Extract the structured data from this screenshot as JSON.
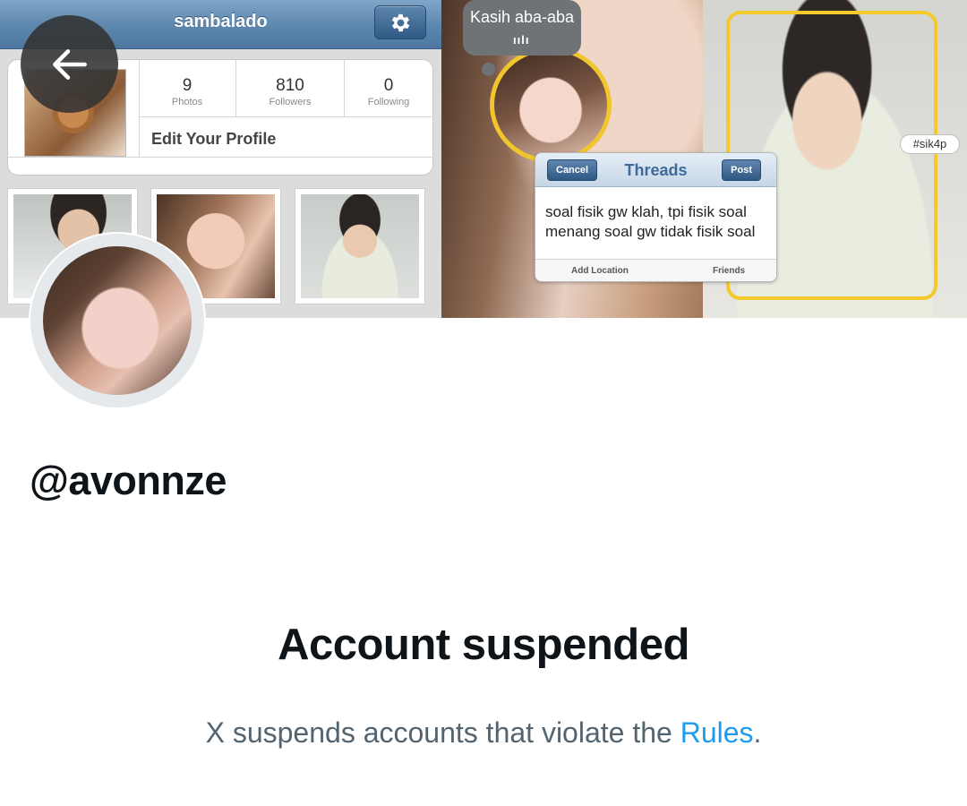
{
  "banner": {
    "profile_ui": {
      "username": "sambalado",
      "stats": [
        {
          "value": "9",
          "label": "Photos"
        },
        {
          "value": "810",
          "label": "Followers"
        },
        {
          "value": "0",
          "label": "Following"
        }
      ],
      "edit_label": "Edit Your Profile"
    },
    "speech_bubble": {
      "text": "Kasih aba-aba",
      "wave": "ıılı"
    },
    "threads_dialog": {
      "cancel_label": "Cancel",
      "title": "Threads",
      "post_label": "Post",
      "body_line1": "soal fisik gw klah, tpi fisik soal",
      "body_line2": "menang soal gw tidak fisik soal",
      "location_label": "Add Location",
      "friends_label": "Friends"
    },
    "tag": "#sik4p"
  },
  "profile": {
    "handle": "@avonnze"
  },
  "suspension": {
    "title": "Account suspended",
    "desc_prefix": "X suspends accounts that violate the ",
    "rules_link": "Rules",
    "desc_suffix": "."
  },
  "icons": {
    "back": "arrow-left-icon",
    "settings": "gear-icon"
  },
  "colors": {
    "link": "#1d9bf0",
    "secondary_text": "#536471",
    "primary_text": "#0f1419",
    "frame_yellow": "#f3c92c"
  }
}
